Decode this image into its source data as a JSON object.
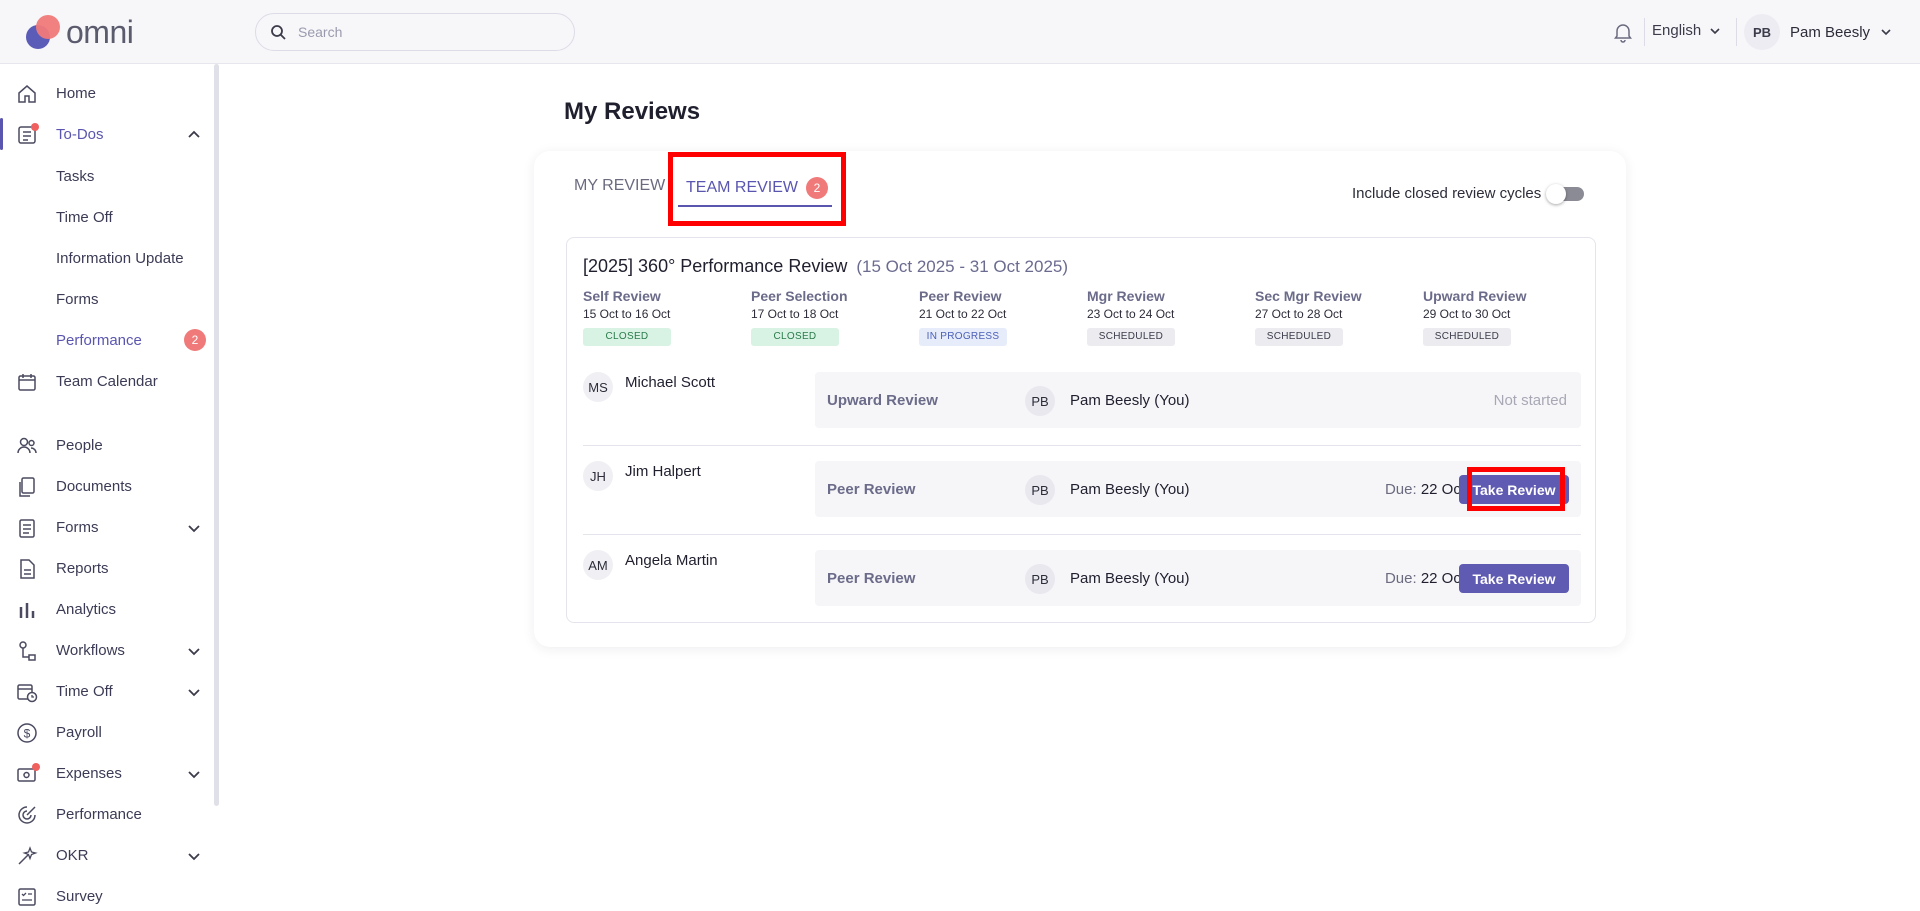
{
  "app": {
    "logo_text": "omni"
  },
  "header": {
    "search_placeholder": "Search",
    "language": "English",
    "user_initials": "PB",
    "user_name": "Pam Beesly"
  },
  "sidebar": {
    "items": {
      "home": "Home",
      "todos": "To-Dos",
      "tasks": "Tasks",
      "timeoff_sub": "Time Off",
      "info_update": "Information Update",
      "forms_sub": "Forms",
      "performance_sub": "Performance",
      "performance_count": "2",
      "team_calendar": "Team Calendar",
      "people": "People",
      "documents": "Documents",
      "forms": "Forms",
      "reports": "Reports",
      "analytics": "Analytics",
      "workflows": "Workflows",
      "timeoff": "Time Off",
      "payroll": "Payroll",
      "expenses": "Expenses",
      "performance": "Performance",
      "okr": "OKR",
      "survey": "Survey"
    }
  },
  "main": {
    "title": "My Reviews",
    "tabs": {
      "my_review": "MY REVIEW",
      "team_review": "TEAM REVIEW",
      "team_review_count": "2"
    },
    "toggle_label": "Include closed review cycles",
    "cycle": {
      "title": "[2025] 360° Performance Review",
      "range": "(15 Oct 2025 - 31 Oct 2025)",
      "phases": [
        {
          "name": "Self Review",
          "dates": "15 Oct to 16 Oct",
          "status": "CLOSED"
        },
        {
          "name": "Peer Selection",
          "dates": "17 Oct to 18 Oct",
          "status": "CLOSED"
        },
        {
          "name": "Peer Review",
          "dates": "21 Oct to 22 Oct",
          "status": "IN PROGRESS"
        },
        {
          "name": "Mgr Review",
          "dates": "23 Oct to 24 Oct",
          "status": "SCHEDULED"
        },
        {
          "name": "Sec Mgr Review",
          "dates": "27 Oct to 28 Oct",
          "status": "SCHEDULED"
        },
        {
          "name": "Upward Review",
          "dates": "29 Oct to 30 Oct",
          "status": "SCHEDULED"
        }
      ],
      "reviews": [
        {
          "initials": "MS",
          "name": "Michael Scott",
          "type": "Upward Review",
          "reviewer_initials": "PB",
          "reviewer": "Pam Beesly (You)",
          "status": "Not started"
        },
        {
          "initials": "JH",
          "name": "Jim Halpert",
          "type": "Peer Review",
          "reviewer_initials": "PB",
          "reviewer": "Pam Beesly (You)",
          "due_label": "Due:",
          "due_date": "22 Oct",
          "action": "Take Review"
        },
        {
          "initials": "AM",
          "name": "Angela Martin",
          "type": "Peer Review",
          "reviewer_initials": "PB",
          "reviewer": "Pam Beesly (You)",
          "due_label": "Due:",
          "due_date": "22 Oct",
          "action": "Take Review"
        }
      ]
    }
  },
  "colors": {
    "accent": "#5a56b0",
    "badge": "#f07a7a",
    "highlight": "#ff0000"
  }
}
